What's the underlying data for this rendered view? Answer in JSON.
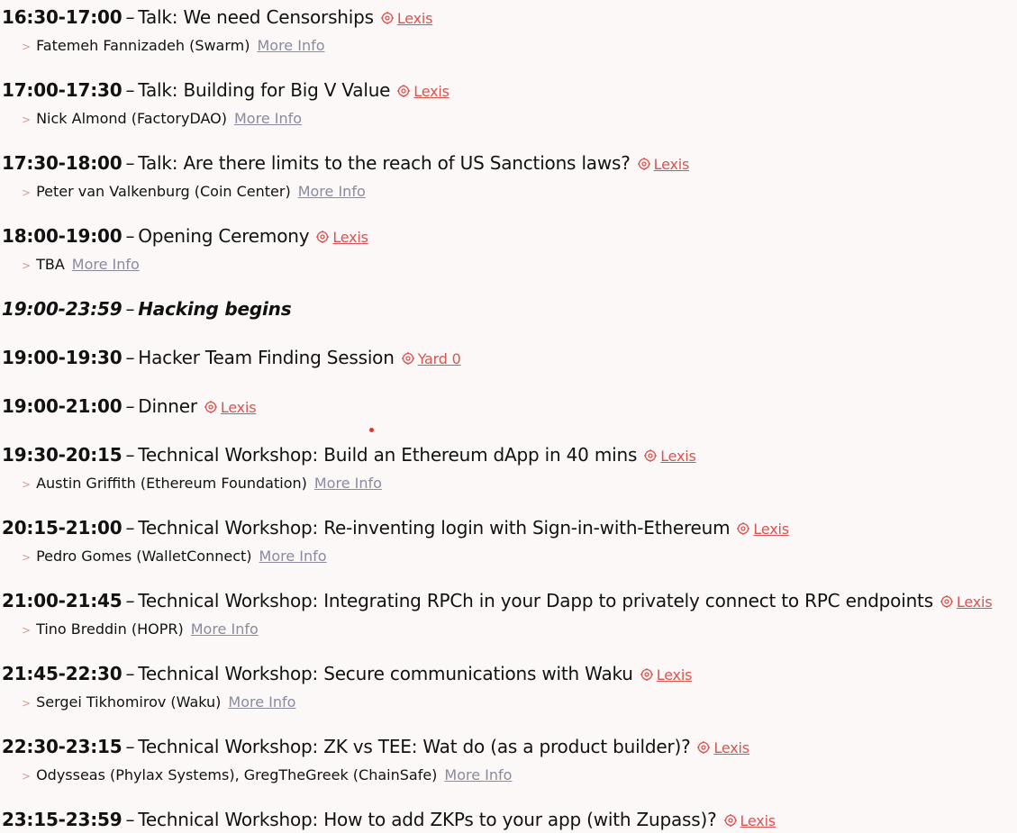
{
  "entries": [
    {
      "time": "16:30-17:00",
      "event": "Talk: We need Censorships",
      "location": "Lexis",
      "speaker": "Fatemeh Fannizadeh (Swarm)",
      "more": "More Info"
    },
    {
      "time": "17:00-17:30",
      "event": "Talk: Building for Big V Value",
      "location": "Lexis",
      "speaker": "Nick Almond (FactoryDAO)",
      "more": "More Info"
    },
    {
      "time": "17:30-18:00",
      "event": "Talk: Are there limits to the reach of US Sanctions laws?",
      "location": "Lexis",
      "speaker": "Peter van Valkenburg (Coin Center)",
      "more": "More Info"
    },
    {
      "time": "18:00-19:00",
      "event": "Opening Ceremony",
      "location": "Lexis",
      "speaker": "TBA",
      "more": "More Info"
    },
    {
      "time": "19:00-23:59",
      "event": "Hacking begins",
      "italic": true
    },
    {
      "time": "19:00-19:30",
      "event": "Hacker Team Finding Session",
      "location": "Yard 0"
    },
    {
      "time": "19:00-21:00",
      "event": "Dinner",
      "location": "Lexis"
    },
    {
      "time": "19:30-20:15",
      "event": "Technical Workshop: Build an Ethereum dApp in 40 mins",
      "location": "Lexis",
      "speaker": "Austin Griffith (Ethereum Foundation)",
      "more": "More Info"
    },
    {
      "time": "20:15-21:00",
      "event": "Technical Workshop: Re-inventing login with Sign-in-with-Ethereum",
      "location": "Lexis",
      "speaker": "Pedro Gomes (WalletConnect)",
      "more": "More Info"
    },
    {
      "time": "21:00-21:45",
      "event": "Technical Workshop: Integrating RPCh in your Dapp to privately connect to RPC endpoints",
      "location": "Lexis",
      "speaker": "Tino Breddin (HOPR)",
      "more": "More Info"
    },
    {
      "time": "21:45-22:30",
      "event": "Technical Workshop: Secure communications with Waku",
      "location": "Lexis",
      "speaker": "Sergei Tikhomirov (Waku)",
      "more": "More Info"
    },
    {
      "time": "22:30-23:15",
      "event": "Technical Workshop: ZK vs TEE: Wat do (as a product builder)?",
      "location": "Lexis",
      "speaker": "Odysseas (Phylax Systems), GregTheGreek (ChainSafe)",
      "more": "More Info"
    },
    {
      "time": "23:15-23:59",
      "event": "Technical Workshop: How to add ZKPs to your app (with Zupass)?",
      "location": "Lexis"
    }
  ],
  "dash": "–",
  "chevron": ">",
  "colors": {
    "accent": "#d9534f",
    "muted_link": "#8a8aa0",
    "background": "#fbf8f7"
  }
}
